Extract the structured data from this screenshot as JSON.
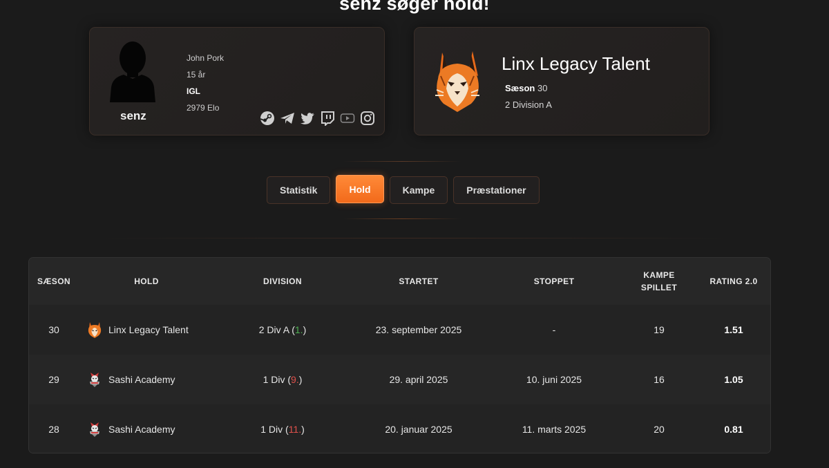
{
  "page_title": "senz søger hold!",
  "player": {
    "name": "senz",
    "real_name": "John Pork",
    "age": "15 år",
    "role": "IGL",
    "elo": "2979 Elo",
    "socials": [
      "steam-icon",
      "telegram-icon",
      "twitter-icon",
      "twitch-icon",
      "youtube-icon",
      "instagram-icon"
    ]
  },
  "team": {
    "name": "Linx Legacy Talent",
    "season_label": "Sæson",
    "season_value": "30",
    "division": "2 Division A"
  },
  "tabs": [
    {
      "label": "Statistik",
      "active": false
    },
    {
      "label": "Hold",
      "active": true
    },
    {
      "label": "Kampe",
      "active": false
    },
    {
      "label": "Præstationer",
      "active": false
    }
  ],
  "table": {
    "headers": {
      "season": "SÆSON",
      "team": "HOLD",
      "division": "DIVISION",
      "started": "STARTET",
      "stopped": "STOPPET",
      "matches_line1": "KAMPE",
      "matches_line2": "SPILLET",
      "rating": "RATING 2.0"
    },
    "rows": [
      {
        "season": "30",
        "team": "Linx Legacy Talent",
        "division_prefix": "2 Div A (",
        "position": "1.",
        "division_suffix": ")",
        "started": "23. september 2025",
        "stopped": "-",
        "matches": "19",
        "rating": "1.51"
      },
      {
        "season": "29",
        "team": "Sashi Academy",
        "division_prefix": "1 Div (",
        "position": "9.",
        "division_suffix": ")",
        "started": "29. april 2025",
        "stopped": "10. juni 2025",
        "matches": "16",
        "rating": "1.05"
      },
      {
        "season": "28",
        "team": "Sashi Academy",
        "division_prefix": "1 Div (",
        "position": "11.",
        "division_suffix": ")",
        "started": "20. januar 2025",
        "stopped": "11. marts 2025",
        "matches": "20",
        "rating": "0.81"
      }
    ]
  },
  "colors": {
    "accent": "#f57a27",
    "position_good": "#4caf50",
    "position_bad": "#e0514c"
  }
}
